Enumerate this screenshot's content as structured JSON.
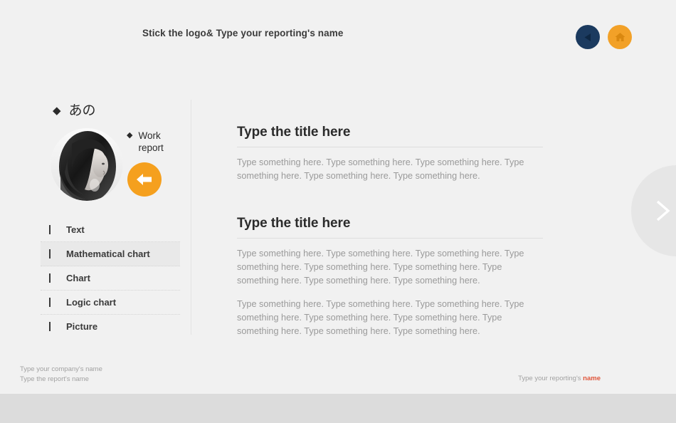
{
  "page": {
    "background_color": "#f1f1f1",
    "bottom_strip_color": "#dcdcdc"
  },
  "header": {
    "title": "Stick the logo& Type your reporting's name",
    "buttons": [
      {
        "name": "back-button",
        "icon": "triangle-left-icon",
        "color": "#1b3a5f"
      },
      {
        "name": "home-button",
        "icon": "home-icon",
        "color": "#f2a128"
      }
    ]
  },
  "sidebar": {
    "kicker": {
      "bullet": "◆",
      "label": "あの"
    },
    "portrait_alt": "portrait-photo",
    "work_report": {
      "bullet": "◆",
      "label": "Work report"
    },
    "arrow_button": {
      "icon": "arrow-left-icon",
      "color": "#f5a01e"
    },
    "menu": [
      {
        "label": "Text",
        "active": false
      },
      {
        "label": "Mathematical chart",
        "active": true
      },
      {
        "label": "Chart",
        "active": false
      },
      {
        "label": "Logic chart",
        "active": false
      },
      {
        "label": "Picture",
        "active": false
      }
    ]
  },
  "main": {
    "sections": [
      {
        "title": "Type the title here",
        "paragraphs": [
          "Type something here. Type something here. Type something here. Type something here. Type something here. Type something here."
        ]
      },
      {
        "title": "Type the title here",
        "paragraphs": [
          "Type something here. Type something here. Type something here. Type something here. Type something here. Type something here. Type something here. Type something here. Type something here.",
          "Type something here. Type something here. Type something here. Type something here. Type something here. Type something here. Type something here. Type something here. Type something here."
        ]
      }
    ]
  },
  "footer": {
    "company_line": "Type your company's name",
    "report_line": "Type the report's name",
    "right_prefix": "Type your reporting's ",
    "right_accent": "name",
    "accent_color": "#e0553a"
  },
  "nav": {
    "next_icon": "chevron-right-icon"
  }
}
